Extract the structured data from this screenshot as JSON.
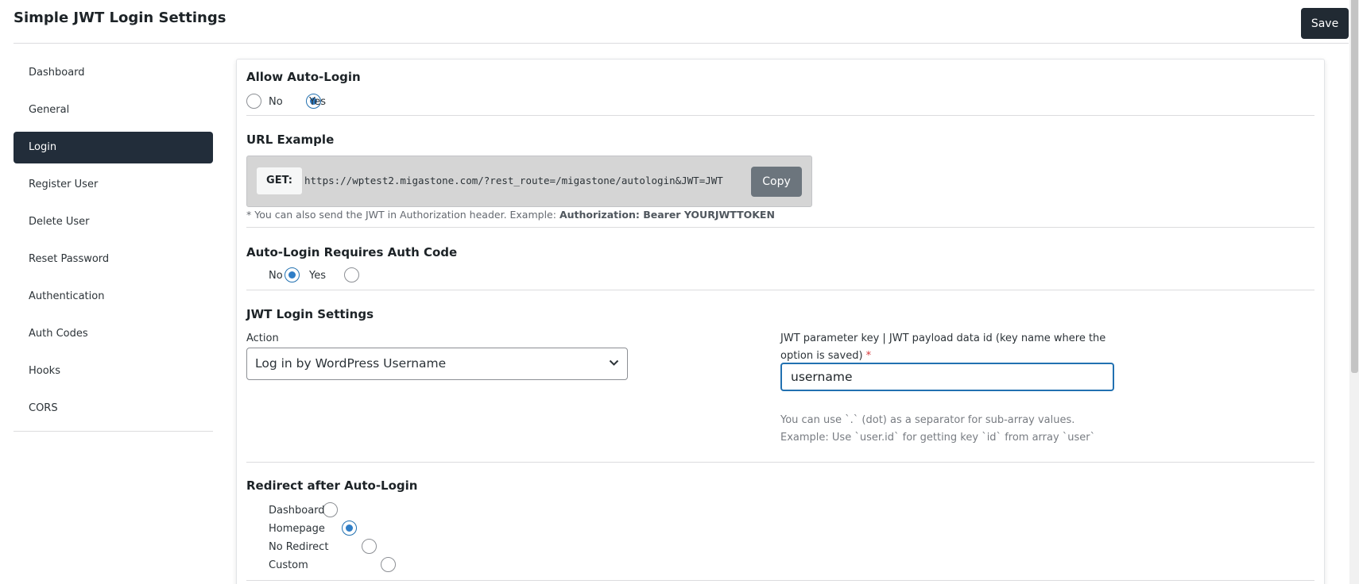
{
  "header": {
    "title": "Simple JWT Login Settings",
    "save_label": "Save"
  },
  "sidebar": {
    "items": [
      {
        "label": "Dashboard",
        "active": false
      },
      {
        "label": "General",
        "active": false
      },
      {
        "label": "Login",
        "active": true
      },
      {
        "label": "Register User",
        "active": false
      },
      {
        "label": "Delete User",
        "active": false
      },
      {
        "label": "Reset Password",
        "active": false
      },
      {
        "label": "Authentication",
        "active": false
      },
      {
        "label": "Auth Codes",
        "active": false
      },
      {
        "label": "Hooks",
        "active": false
      },
      {
        "label": "CORS",
        "active": false
      }
    ]
  },
  "allow_auto_login": {
    "title": "Allow Auto-Login",
    "no_label": "No",
    "yes_label": "Yes",
    "selected": "Yes"
  },
  "url_example": {
    "title": "URL Example",
    "method": "GET:",
    "url": "https://wptest2.migastone.com/?rest_route=/migastone/autologin&JWT=JWT",
    "copy_label": "Copy",
    "hint_prefix": "* You can also send the JWT in Authorization header. Example: ",
    "hint_bold": "Authorization: Bearer YOURJWTTOKEN"
  },
  "auth_code": {
    "title": "Auto-Login Requires Auth Code",
    "no_label": "No",
    "yes_label": "Yes",
    "selected": "No"
  },
  "jwt_login_settings": {
    "title": "JWT Login Settings",
    "action_label": "Action",
    "action_value": "Log in by WordPress Username",
    "param_label_line1": "JWT parameter key | JWT payload data id (key name where the",
    "param_label_line2": "option is saved)",
    "required_mark": "*",
    "param_value": "username",
    "hint_line1": "You can use `.` (dot) as a separator for sub-array values.",
    "hint_line2": "Example: Use `user.id` for getting key `id` from array `user`"
  },
  "redirect": {
    "title": "Redirect after Auto-Login",
    "options": [
      "Dashboard",
      "Homepage",
      "No Redirect",
      "Custom"
    ],
    "selected": "Homepage"
  },
  "colors": {
    "accent": "#2271b1",
    "nav_active_bg": "#222d3a",
    "save_bg": "#212a33",
    "copy_bg": "#6c757d"
  },
  "icons": {
    "select_arrow": "chevron-down-icon"
  }
}
